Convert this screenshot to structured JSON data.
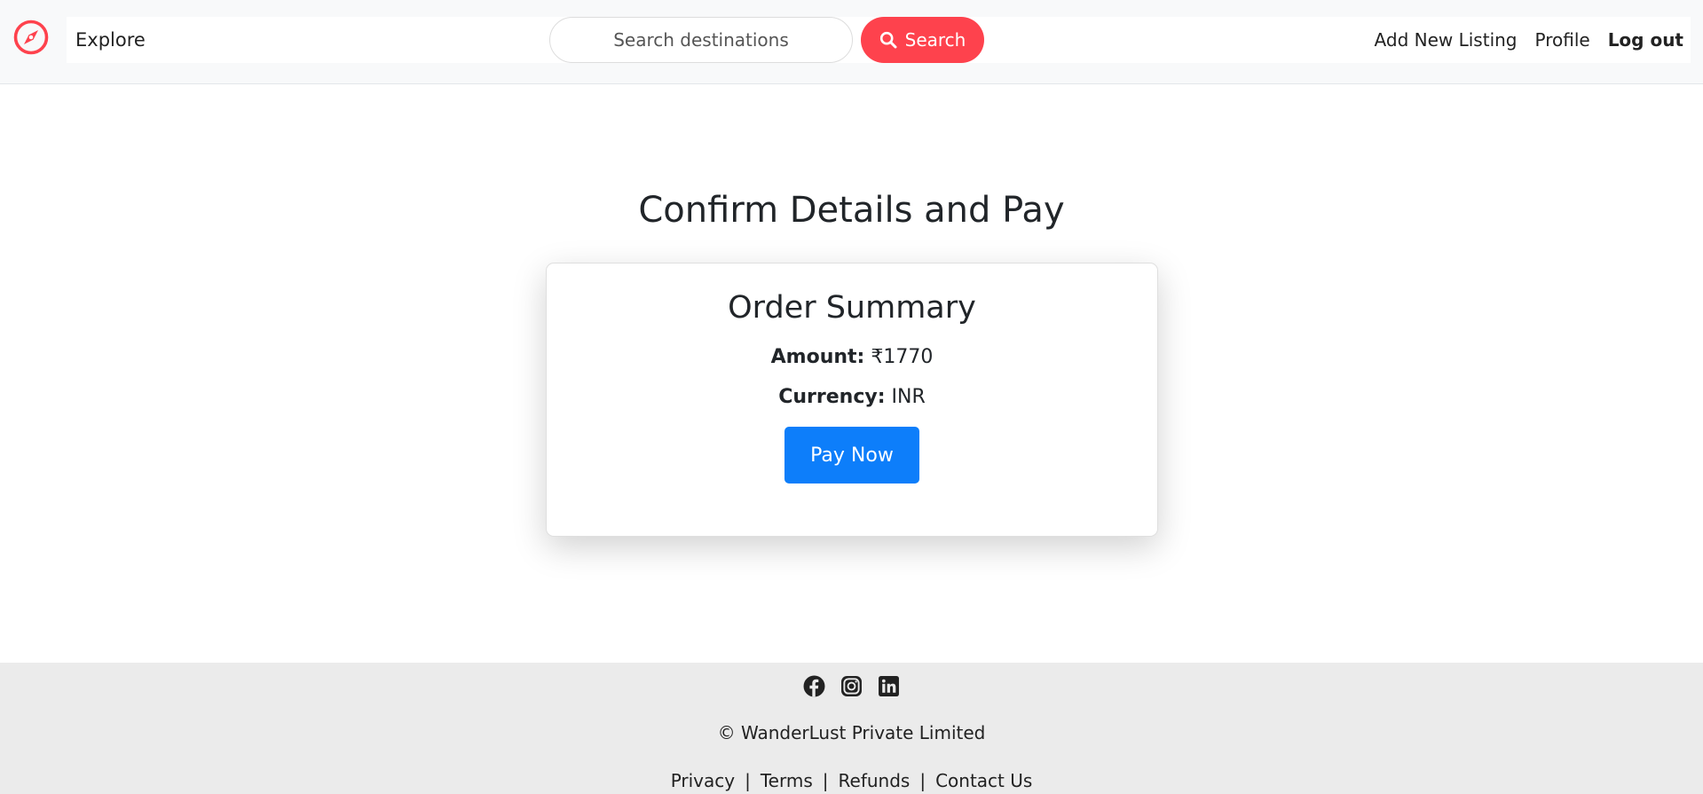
{
  "theme": {
    "brand": "#fe424d",
    "pay_button": "#0d7efa",
    "footer_bg": "#ebebeb"
  },
  "navbar": {
    "logo_icon": "compass-icon",
    "explore_label": "Explore",
    "search": {
      "placeholder": "Search destinations",
      "value": "",
      "button_label": "Search",
      "button_icon": "search-icon"
    },
    "links": {
      "add_listing": "Add New Listing",
      "profile": "Profile",
      "logout": "Log out"
    }
  },
  "main": {
    "title": "Confirm Details and Pay",
    "order_summary": {
      "heading": "Order Summary",
      "amount_label": "Amount:",
      "amount_value": "₹1770",
      "currency_label": "Currency:",
      "currency_value": "INR",
      "pay_label": "Pay Now"
    }
  },
  "footer": {
    "social_icons": [
      "facebook-icon",
      "instagram-icon",
      "linkedin-icon"
    ],
    "copyright": "© WanderLust Private Limited",
    "links": [
      "Privacy",
      "Terms",
      "Refunds",
      "Contact Us"
    ],
    "separator": "|"
  }
}
